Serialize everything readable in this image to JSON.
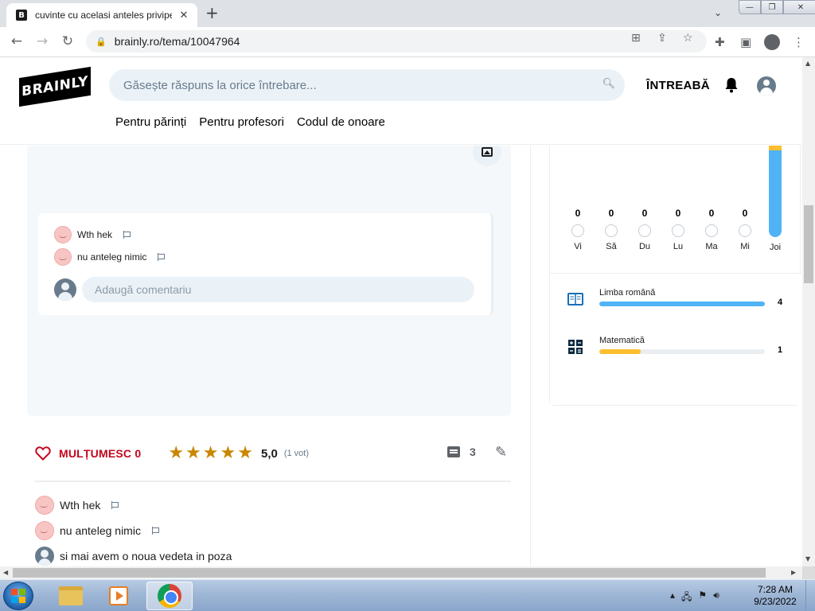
{
  "browser": {
    "tab_title": "cuvinte cu acelasi anteles privipe",
    "tab_favicon": "B",
    "url": "brainly.ro/tema/10047964"
  },
  "site": {
    "logo_text": "BRAINLY",
    "search_placeholder": "Găsește răspuns la orice întrebare...",
    "ask_label": "ÎNTREABĂ",
    "nav": [
      "Pentru părinți",
      "Pentru profesori",
      "Codul de onoare"
    ]
  },
  "answer": {
    "card_comments": [
      {
        "author": "Wth hek"
      },
      {
        "author": "nu anteleg nimic"
      }
    ],
    "add_comment_placeholder": "Adaugă comentariu",
    "thanks_label": "MULȚUMESC 0",
    "rating_value": "5,0",
    "stars": 5,
    "votes_label": "(1 vot)",
    "comment_count": "3",
    "comments": [
      {
        "text": "Wth hek"
      },
      {
        "text": "nu anteleg nimic"
      },
      {
        "text": "si mai avem o noua vedeta in poza"
      }
    ]
  },
  "activity": {
    "days": [
      {
        "label": "Vi",
        "count": "0"
      },
      {
        "label": "Să",
        "count": "0"
      },
      {
        "label": "Du",
        "count": "0"
      },
      {
        "label": "Lu",
        "count": "0"
      },
      {
        "label": "Ma",
        "count": "0"
      },
      {
        "label": "Mi",
        "count": "0"
      }
    ],
    "today_label": "Joi",
    "subjects": [
      {
        "name": "Limba română",
        "count": "4",
        "fraction": 1.0,
        "color": "#4fb3f6"
      },
      {
        "name": "Matematică",
        "count": "1",
        "fraction": 0.25,
        "color": "#fbbe2e"
      }
    ]
  },
  "taskbar": {
    "time": "7:28 AM",
    "date": "9/23/2022"
  },
  "colors": {
    "accent_red": "#c3051d",
    "star": "#c98600",
    "blue": "#4fb3f6",
    "yellow": "#fbbe2e"
  }
}
